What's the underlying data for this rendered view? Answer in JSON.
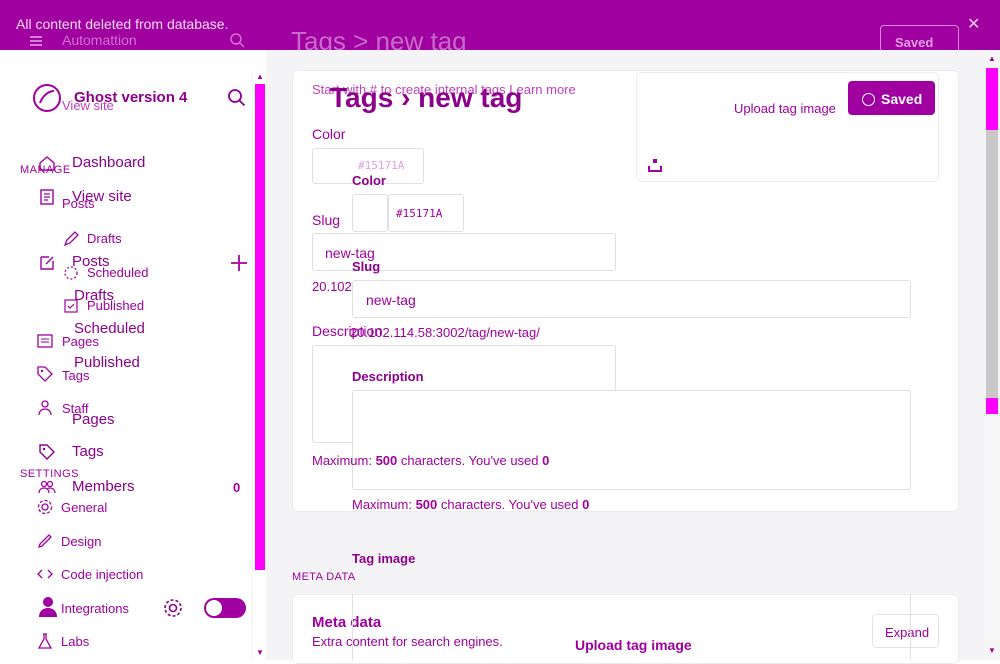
{
  "banner": {
    "message": "All content deleted from database.",
    "ghost_title": "Tags > new tag",
    "ghost_app": "Automattion",
    "ghost_saved": "Saved",
    "close": "✕"
  },
  "sidebar": {
    "brand": "Ghost version 4",
    "view_site": "View site",
    "view_site_ghost": "View site",
    "manage_head": "MANAGE",
    "settings_head": "SETTINGS",
    "nav": {
      "dashboard": "Dashboard",
      "posts": "Posts",
      "posts_ghost": "Posts",
      "drafts": "Drafts",
      "drafts_ghost": "Drafts",
      "scheduled": "Scheduled",
      "scheduled_ghost": "Scheduled",
      "published": "Published",
      "published_ghost": "Published",
      "pages": "Pages",
      "pages_ghost": "Pages",
      "tags": "Tags",
      "tags_ghost": "Tags",
      "staff": "Staff",
      "members": "Members",
      "members_count": "0",
      "general": "General",
      "design": "Design",
      "code_injection": "Code injection",
      "integrations": "Integrations",
      "labs": "Labs"
    }
  },
  "main": {
    "title": "Tags",
    "title_sep": "›",
    "title_item": "new tag",
    "saved_button": "Saved",
    "hint": "Start with # to create internal tags Learn more",
    "upload_tag_image": "Upload tag image",
    "upload_tag_image_ghost": "Upload tag image",
    "color_label": "Color",
    "color_label_2": "Color",
    "color_value": "#15171A",
    "color_value_ghost": "#15171A",
    "slug_label": "Slug",
    "slug_label_2": "Slug",
    "slug_value": "new-tag",
    "slug_value_2": "new-tag",
    "url_ghost": "20.102.114.58/tag/new-tag/",
    "url": "20.102.114.58:3002/tag/new-tag/",
    "description_label": "Description",
    "description_label_2": "Description",
    "max_ghost_prefix": "Maximum: ",
    "max_ghost_num": "500",
    "max_ghost_rest": " characters. You've used ",
    "max_ghost_used": "0",
    "max_prefix": "Maximum: ",
    "max_num": "500",
    "max_rest": " characters. You've used ",
    "max_used": "0",
    "tag_image_label": "Tag image",
    "meta_head": "META DATA",
    "meta_title": "Meta data",
    "meta_sub": "Extra content for search engines.",
    "expand_button": "Expand"
  },
  "colors": {
    "accent": "#a000a0",
    "highlight": "#ff00ff"
  },
  "icons": [
    "hamburger-icon",
    "search-icon",
    "ghost-logo-icon",
    "home-icon",
    "posts-icon",
    "edit-icon",
    "plus-icon",
    "pages-icon",
    "tag-icon",
    "staff-icon",
    "members-icon",
    "gear-icon",
    "brush-icon",
    "code-icon",
    "integrations-icon",
    "labs-icon",
    "avatar-icon",
    "upload-icon",
    "check-icon"
  ]
}
